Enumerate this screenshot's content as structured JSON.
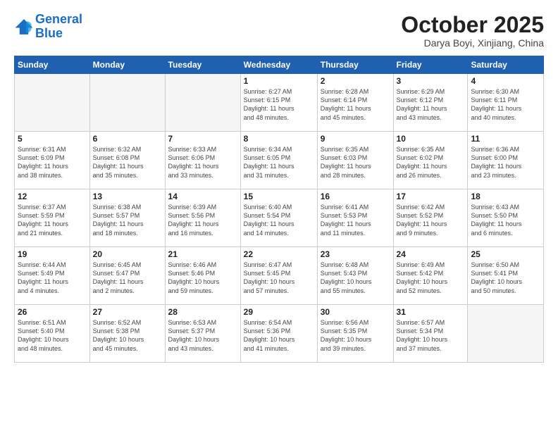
{
  "header": {
    "logo_line1": "General",
    "logo_line2": "Blue",
    "month": "October 2025",
    "location": "Darya Boyi, Xinjiang, China"
  },
  "weekdays": [
    "Sunday",
    "Monday",
    "Tuesday",
    "Wednesday",
    "Thursday",
    "Friday",
    "Saturday"
  ],
  "weeks": [
    [
      {
        "day": "",
        "info": ""
      },
      {
        "day": "",
        "info": ""
      },
      {
        "day": "",
        "info": ""
      },
      {
        "day": "1",
        "info": "Sunrise: 6:27 AM\nSunset: 6:15 PM\nDaylight: 11 hours\nand 48 minutes."
      },
      {
        "day": "2",
        "info": "Sunrise: 6:28 AM\nSunset: 6:14 PM\nDaylight: 11 hours\nand 45 minutes."
      },
      {
        "day": "3",
        "info": "Sunrise: 6:29 AM\nSunset: 6:12 PM\nDaylight: 11 hours\nand 43 minutes."
      },
      {
        "day": "4",
        "info": "Sunrise: 6:30 AM\nSunset: 6:11 PM\nDaylight: 11 hours\nand 40 minutes."
      }
    ],
    [
      {
        "day": "5",
        "info": "Sunrise: 6:31 AM\nSunset: 6:09 PM\nDaylight: 11 hours\nand 38 minutes."
      },
      {
        "day": "6",
        "info": "Sunrise: 6:32 AM\nSunset: 6:08 PM\nDaylight: 11 hours\nand 35 minutes."
      },
      {
        "day": "7",
        "info": "Sunrise: 6:33 AM\nSunset: 6:06 PM\nDaylight: 11 hours\nand 33 minutes."
      },
      {
        "day": "8",
        "info": "Sunrise: 6:34 AM\nSunset: 6:05 PM\nDaylight: 11 hours\nand 31 minutes."
      },
      {
        "day": "9",
        "info": "Sunrise: 6:35 AM\nSunset: 6:03 PM\nDaylight: 11 hours\nand 28 minutes."
      },
      {
        "day": "10",
        "info": "Sunrise: 6:35 AM\nSunset: 6:02 PM\nDaylight: 11 hours\nand 26 minutes."
      },
      {
        "day": "11",
        "info": "Sunrise: 6:36 AM\nSunset: 6:00 PM\nDaylight: 11 hours\nand 23 minutes."
      }
    ],
    [
      {
        "day": "12",
        "info": "Sunrise: 6:37 AM\nSunset: 5:59 PM\nDaylight: 11 hours\nand 21 minutes."
      },
      {
        "day": "13",
        "info": "Sunrise: 6:38 AM\nSunset: 5:57 PM\nDaylight: 11 hours\nand 18 minutes."
      },
      {
        "day": "14",
        "info": "Sunrise: 6:39 AM\nSunset: 5:56 PM\nDaylight: 11 hours\nand 16 minutes."
      },
      {
        "day": "15",
        "info": "Sunrise: 6:40 AM\nSunset: 5:54 PM\nDaylight: 11 hours\nand 14 minutes."
      },
      {
        "day": "16",
        "info": "Sunrise: 6:41 AM\nSunset: 5:53 PM\nDaylight: 11 hours\nand 11 minutes."
      },
      {
        "day": "17",
        "info": "Sunrise: 6:42 AM\nSunset: 5:52 PM\nDaylight: 11 hours\nand 9 minutes."
      },
      {
        "day": "18",
        "info": "Sunrise: 6:43 AM\nSunset: 5:50 PM\nDaylight: 11 hours\nand 6 minutes."
      }
    ],
    [
      {
        "day": "19",
        "info": "Sunrise: 6:44 AM\nSunset: 5:49 PM\nDaylight: 11 hours\nand 4 minutes."
      },
      {
        "day": "20",
        "info": "Sunrise: 6:45 AM\nSunset: 5:47 PM\nDaylight: 11 hours\nand 2 minutes."
      },
      {
        "day": "21",
        "info": "Sunrise: 6:46 AM\nSunset: 5:46 PM\nDaylight: 10 hours\nand 59 minutes."
      },
      {
        "day": "22",
        "info": "Sunrise: 6:47 AM\nSunset: 5:45 PM\nDaylight: 10 hours\nand 57 minutes."
      },
      {
        "day": "23",
        "info": "Sunrise: 6:48 AM\nSunset: 5:43 PM\nDaylight: 10 hours\nand 55 minutes."
      },
      {
        "day": "24",
        "info": "Sunrise: 6:49 AM\nSunset: 5:42 PM\nDaylight: 10 hours\nand 52 minutes."
      },
      {
        "day": "25",
        "info": "Sunrise: 6:50 AM\nSunset: 5:41 PM\nDaylight: 10 hours\nand 50 minutes."
      }
    ],
    [
      {
        "day": "26",
        "info": "Sunrise: 6:51 AM\nSunset: 5:40 PM\nDaylight: 10 hours\nand 48 minutes."
      },
      {
        "day": "27",
        "info": "Sunrise: 6:52 AM\nSunset: 5:38 PM\nDaylight: 10 hours\nand 45 minutes."
      },
      {
        "day": "28",
        "info": "Sunrise: 6:53 AM\nSunset: 5:37 PM\nDaylight: 10 hours\nand 43 minutes."
      },
      {
        "day": "29",
        "info": "Sunrise: 6:54 AM\nSunset: 5:36 PM\nDaylight: 10 hours\nand 41 minutes."
      },
      {
        "day": "30",
        "info": "Sunrise: 6:56 AM\nSunset: 5:35 PM\nDaylight: 10 hours\nand 39 minutes."
      },
      {
        "day": "31",
        "info": "Sunrise: 6:57 AM\nSunset: 5:34 PM\nDaylight: 10 hours\nand 37 minutes."
      },
      {
        "day": "",
        "info": ""
      }
    ]
  ]
}
